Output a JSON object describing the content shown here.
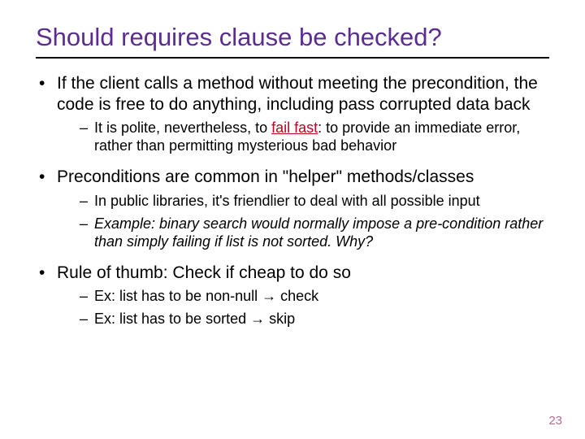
{
  "title": "Should requires clause be checked?",
  "bullets": [
    {
      "text": "If the client calls a method without meeting the precondition, the code is free to do anything, including pass corrupted data back",
      "sub": [
        {
          "pre": "It is polite, nevertheless, to ",
          "ff": "fail fast",
          "post": ": to provide an immediate error, rather than permitting mysterious bad behavior"
        }
      ]
    },
    {
      "text": "Preconditions are common in \"helper\" methods/classes",
      "sub": [
        {
          "text": "In public libraries, it's friendlier to deal with all possible input"
        },
        {
          "text_italic": "Example: binary search would normally impose a pre-condition rather than simply failing if list is not sorted.  Why?"
        }
      ]
    },
    {
      "text": "Rule of thumb: Check if cheap to do so",
      "sub": [
        {
          "text": "Ex: list has to be non-null → check"
        },
        {
          "text": "Ex: list has to be sorted → skip"
        }
      ]
    }
  ],
  "page_number": "23"
}
